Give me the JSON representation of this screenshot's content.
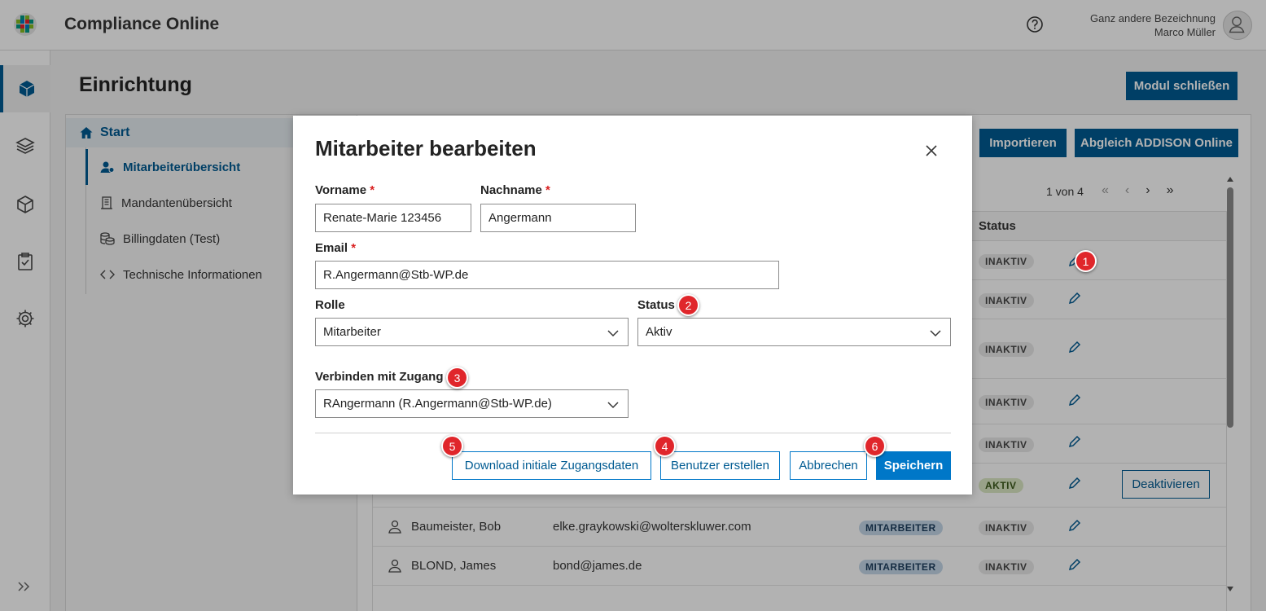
{
  "app": {
    "title": "Compliance Online"
  },
  "user": {
    "org": "Ganz andere Bezeichnung",
    "name": "Marco Müller"
  },
  "page": {
    "title": "Einrichtung",
    "close_module": "Modul schließen"
  },
  "nav": {
    "start": "Start",
    "items": [
      {
        "label": "Mitarbeiterübersicht",
        "icon": "users-icon"
      },
      {
        "label": "Mandantenübersicht",
        "icon": "building-icon"
      },
      {
        "label": "Billingdaten (Test)",
        "icon": "coins-icon"
      },
      {
        "label": "Technische Informationen",
        "icon": "code-icon"
      }
    ]
  },
  "toolbar": {
    "import": "Importieren",
    "abgleich": "Abgleich ADDISON Online"
  },
  "pager": {
    "text": "1 von 4"
  },
  "table": {
    "status_header": "Status",
    "rows": [
      {
        "name": "",
        "email": "",
        "role": "",
        "status": "INAKTIV"
      },
      {
        "name": "",
        "email": "",
        "role": "",
        "status": "INAKTIV"
      },
      {
        "name": "",
        "email": "",
        "role": "",
        "status": "INAKTIV"
      },
      {
        "name": "",
        "email": "",
        "role": "",
        "status": "INAKTIV"
      },
      {
        "name": "",
        "email": "",
        "role": "",
        "status": "INAKTIV"
      },
      {
        "name": "",
        "email": "",
        "role": "",
        "status": "AKTIV",
        "action": "Deaktivieren"
      },
      {
        "name": "Baumeister, Bob",
        "email": "elke.graykowski@wolterskluwer.com",
        "role": "MITARBEITER",
        "status": "INAKTIV"
      },
      {
        "name": "BLOND, James",
        "email": "bond@james.de",
        "role": "MITARBEITER",
        "status": "INAKTIV"
      }
    ]
  },
  "modal": {
    "title": "Mitarbeiter bearbeiten",
    "vorname_label": "Vorname",
    "vorname_value": "Renate-Marie 123456",
    "nachname_label": "Nachname",
    "nachname_value": "Angermann",
    "email_label": "Email",
    "email_value": "R.Angermann@Stb-WP.de",
    "rolle_label": "Rolle",
    "rolle_value": "Mitarbeiter",
    "status_label": "Status",
    "status_value": "Aktiv",
    "zugang_label": "Verbinden mit Zugang",
    "zugang_value": "RAngermann (R.Angermann@Stb-WP.de)",
    "required_mark": "*",
    "btn_download": "Download initiale Zugangsdaten",
    "btn_create": "Benutzer erstellen",
    "btn_cancel": "Abbrechen",
    "btn_save": "Speichern"
  },
  "markers": [
    "1",
    "2",
    "3",
    "4",
    "5",
    "6"
  ],
  "colors": {
    "brand": "#005b92",
    "primary_button": "#0077c8",
    "marker": "#e0262b",
    "required": "#d92020"
  }
}
